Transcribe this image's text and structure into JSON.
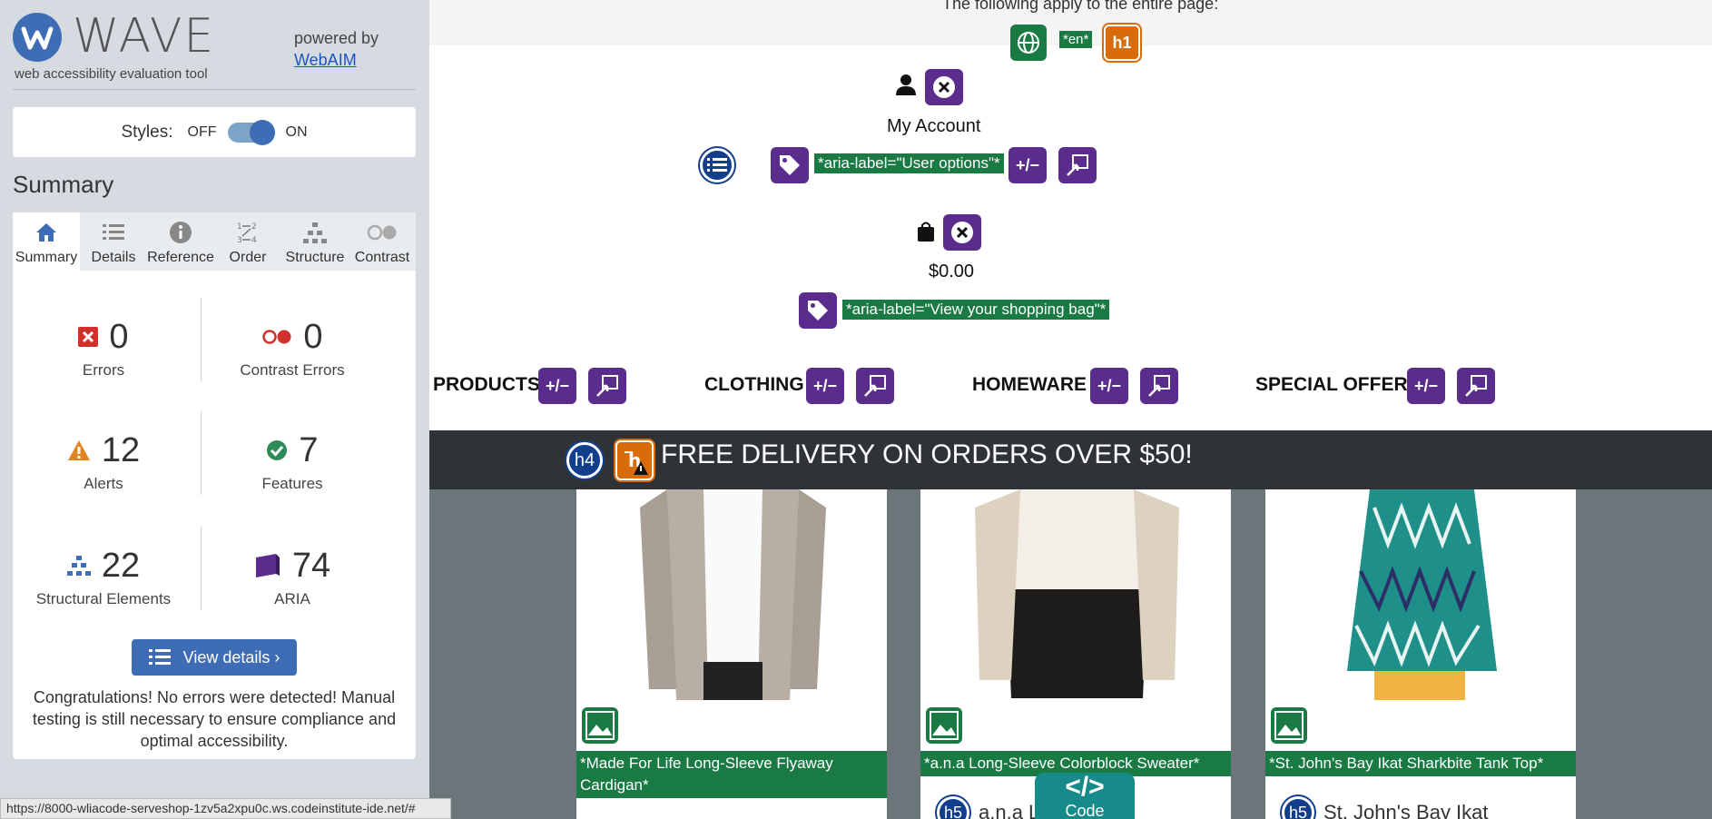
{
  "wave": {
    "logo_text": "WAVE",
    "tagline": "web accessibility evaluation tool",
    "powered_by": "powered by",
    "webaim_link": "WebAIM",
    "styles_label": "Styles:",
    "styles_off": "OFF",
    "styles_on": "ON",
    "summary_heading": "Summary",
    "tabs": [
      {
        "label": "Summary",
        "icon": "home-icon"
      },
      {
        "label": "Details",
        "icon": "list-icon"
      },
      {
        "label": "Reference",
        "icon": "info-icon"
      },
      {
        "label": "Order",
        "icon": "order-icon"
      },
      {
        "label": "Structure",
        "icon": "structure-icon"
      },
      {
        "label": "Contrast",
        "icon": "contrast-icon"
      }
    ],
    "stats": {
      "errors": {
        "value": "0",
        "label": "Errors"
      },
      "contrast_errors": {
        "value": "0",
        "label": "Contrast Errors"
      },
      "alerts": {
        "value": "12",
        "label": "Alerts"
      },
      "features": {
        "value": "7",
        "label": "Features"
      },
      "structural": {
        "value": "22",
        "label": "Structural Elements"
      },
      "aria": {
        "value": "74",
        "label": "ARIA"
      }
    },
    "view_details": "View details ›",
    "congrats": "Congratulations! No errors were detected! Manual testing is still necessary to ensure compliance and optimal accessibility."
  },
  "status_url": "https://8000-wliacode-serveshop-1zv5a2xpu0c.ws.codeinstitute-ide.net/#",
  "page": {
    "top_note": "The following apply to the entire page:",
    "lang_label": "*en*",
    "h1_badge": "h1",
    "my_account": "My Account",
    "user_options_label": "*aria-label=\"User options\"*",
    "bag_total": "$0.00",
    "bag_label": "*aria-label=\"View your shopping bag\"*",
    "nav": [
      "PRODUCTS",
      "CLOTHING",
      "HOMEWARE",
      "SPECIAL OFFERS"
    ],
    "toggle_symbol": "+/−",
    "promo_badge": "h4",
    "promo": "FREE DELIVERY ON ORDERS OVER $50!",
    "products": [
      {
        "alt": "*Made For Life Long-Sleeve Flyaway Cardigan*",
        "name": ""
      },
      {
        "alt": "*a.n.a Long-Sleeve Colorblock Sweater*",
        "name": "a.n.a L"
      },
      {
        "alt": "*St. John's Bay Ikat Sharkbite Tank Top*",
        "name": "St. John's Bay Ikat"
      }
    ],
    "h5_badge": "h5",
    "code_label": "Code",
    "code_symbol": "</>"
  },
  "colors": {
    "wave_blue": "#3e6db5",
    "aria_purple": "#5a2d8c",
    "feature_green": "#1a7a44",
    "promo_bg": "#2f3337"
  }
}
